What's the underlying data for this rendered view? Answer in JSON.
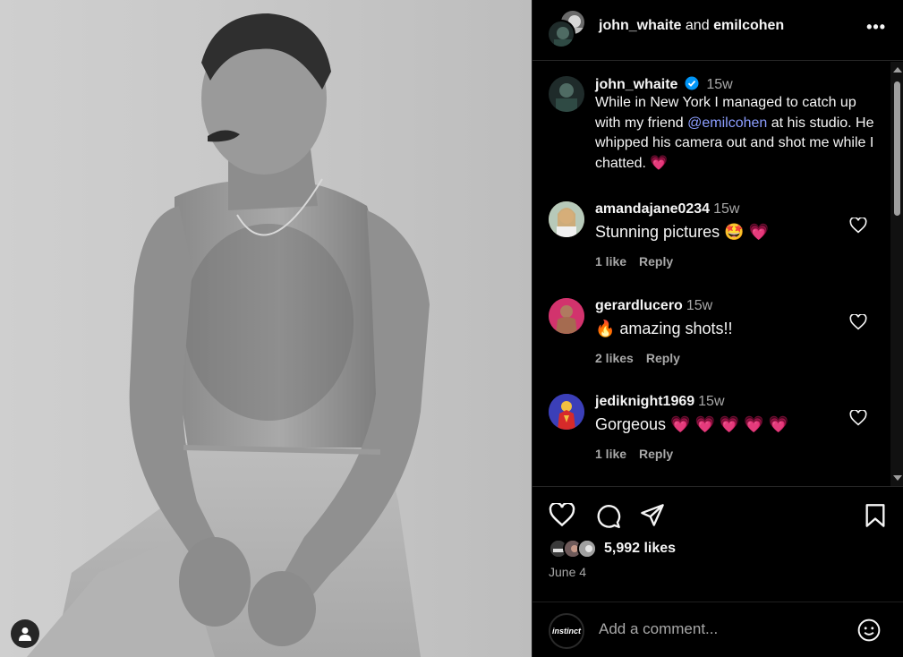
{
  "header": {
    "user1": "john_whaite",
    "joiner": "and",
    "user2": "emilcohen",
    "more_label": "•••"
  },
  "post": {
    "author": "john_whaite",
    "time": "15w",
    "caption_part1": "While in New York I managed to catch up with my friend ",
    "mention": "@emilcohen",
    "caption_part2": " at his studio. He whipped his camera out and shot me while I chatted. ",
    "caption_emoji": "💗"
  },
  "comments": [
    {
      "user": "amandajane0234",
      "time": "15w",
      "text": "Stunning pictures 🤩 💗",
      "likes": "1 like",
      "reply": "Reply"
    },
    {
      "user": "gerardlucero",
      "time": "15w",
      "text": "🔥 amazing shots!!",
      "likes": "2 likes",
      "reply": "Reply"
    },
    {
      "user": "jediknight1969",
      "time": "15w",
      "text": "Gorgeous 💗 💗 💗 💗 💗",
      "likes": "1 like",
      "reply": "Reply"
    }
  ],
  "stats": {
    "likes": "5,992 likes",
    "date": "June 4"
  },
  "composer": {
    "avatar_label": "instinct",
    "placeholder": "Add a comment..."
  },
  "colors": {
    "background": "#000000",
    "mention": "#8c9eff",
    "secondary_text": "#a8a8a8",
    "heart": "#ff3040"
  },
  "icons": [
    "heart-icon",
    "comment-icon",
    "share-icon",
    "bookmark-icon",
    "emoji-icon",
    "verified-icon",
    "user-tag-icon",
    "more-icon"
  ]
}
